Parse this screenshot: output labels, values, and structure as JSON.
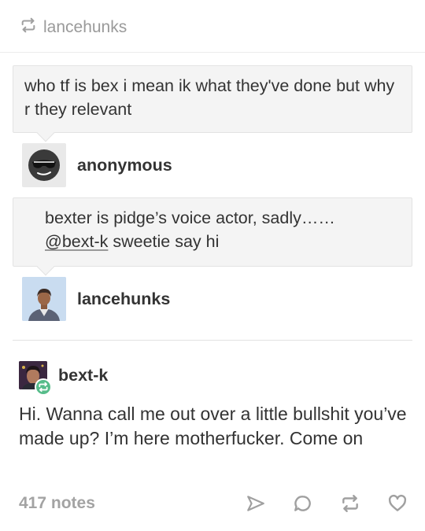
{
  "header": {
    "reblogged_from": "lancehunks",
    "icon": "reblog-icon"
  },
  "ask1": {
    "question": "who tf is bex i mean ik what they've done but why r they relevant",
    "asker": "anonymous",
    "asker_icon": "anonymous-sunglasses-icon"
  },
  "answer": {
    "text_line1": "bexter is pidge’s voice actor, sadly……",
    "mention": "@bext-k",
    "text_rest": " sweetie say hi",
    "author": "lancehunks"
  },
  "post": {
    "author": "bext-k",
    "badge_icon": "reblog-icon",
    "body": "Hi. Wanna call me out over a little bullshit you’ve made up? I’m here motherfucker. Come on"
  },
  "footer": {
    "notes": "417 notes",
    "icons": [
      "share-icon",
      "reply-icon",
      "reblog-icon",
      "like-icon"
    ]
  },
  "colors": {
    "badge": "#56bc8a",
    "muted": "#9a9a9a",
    "bubble_bg": "#f4f4f4"
  }
}
